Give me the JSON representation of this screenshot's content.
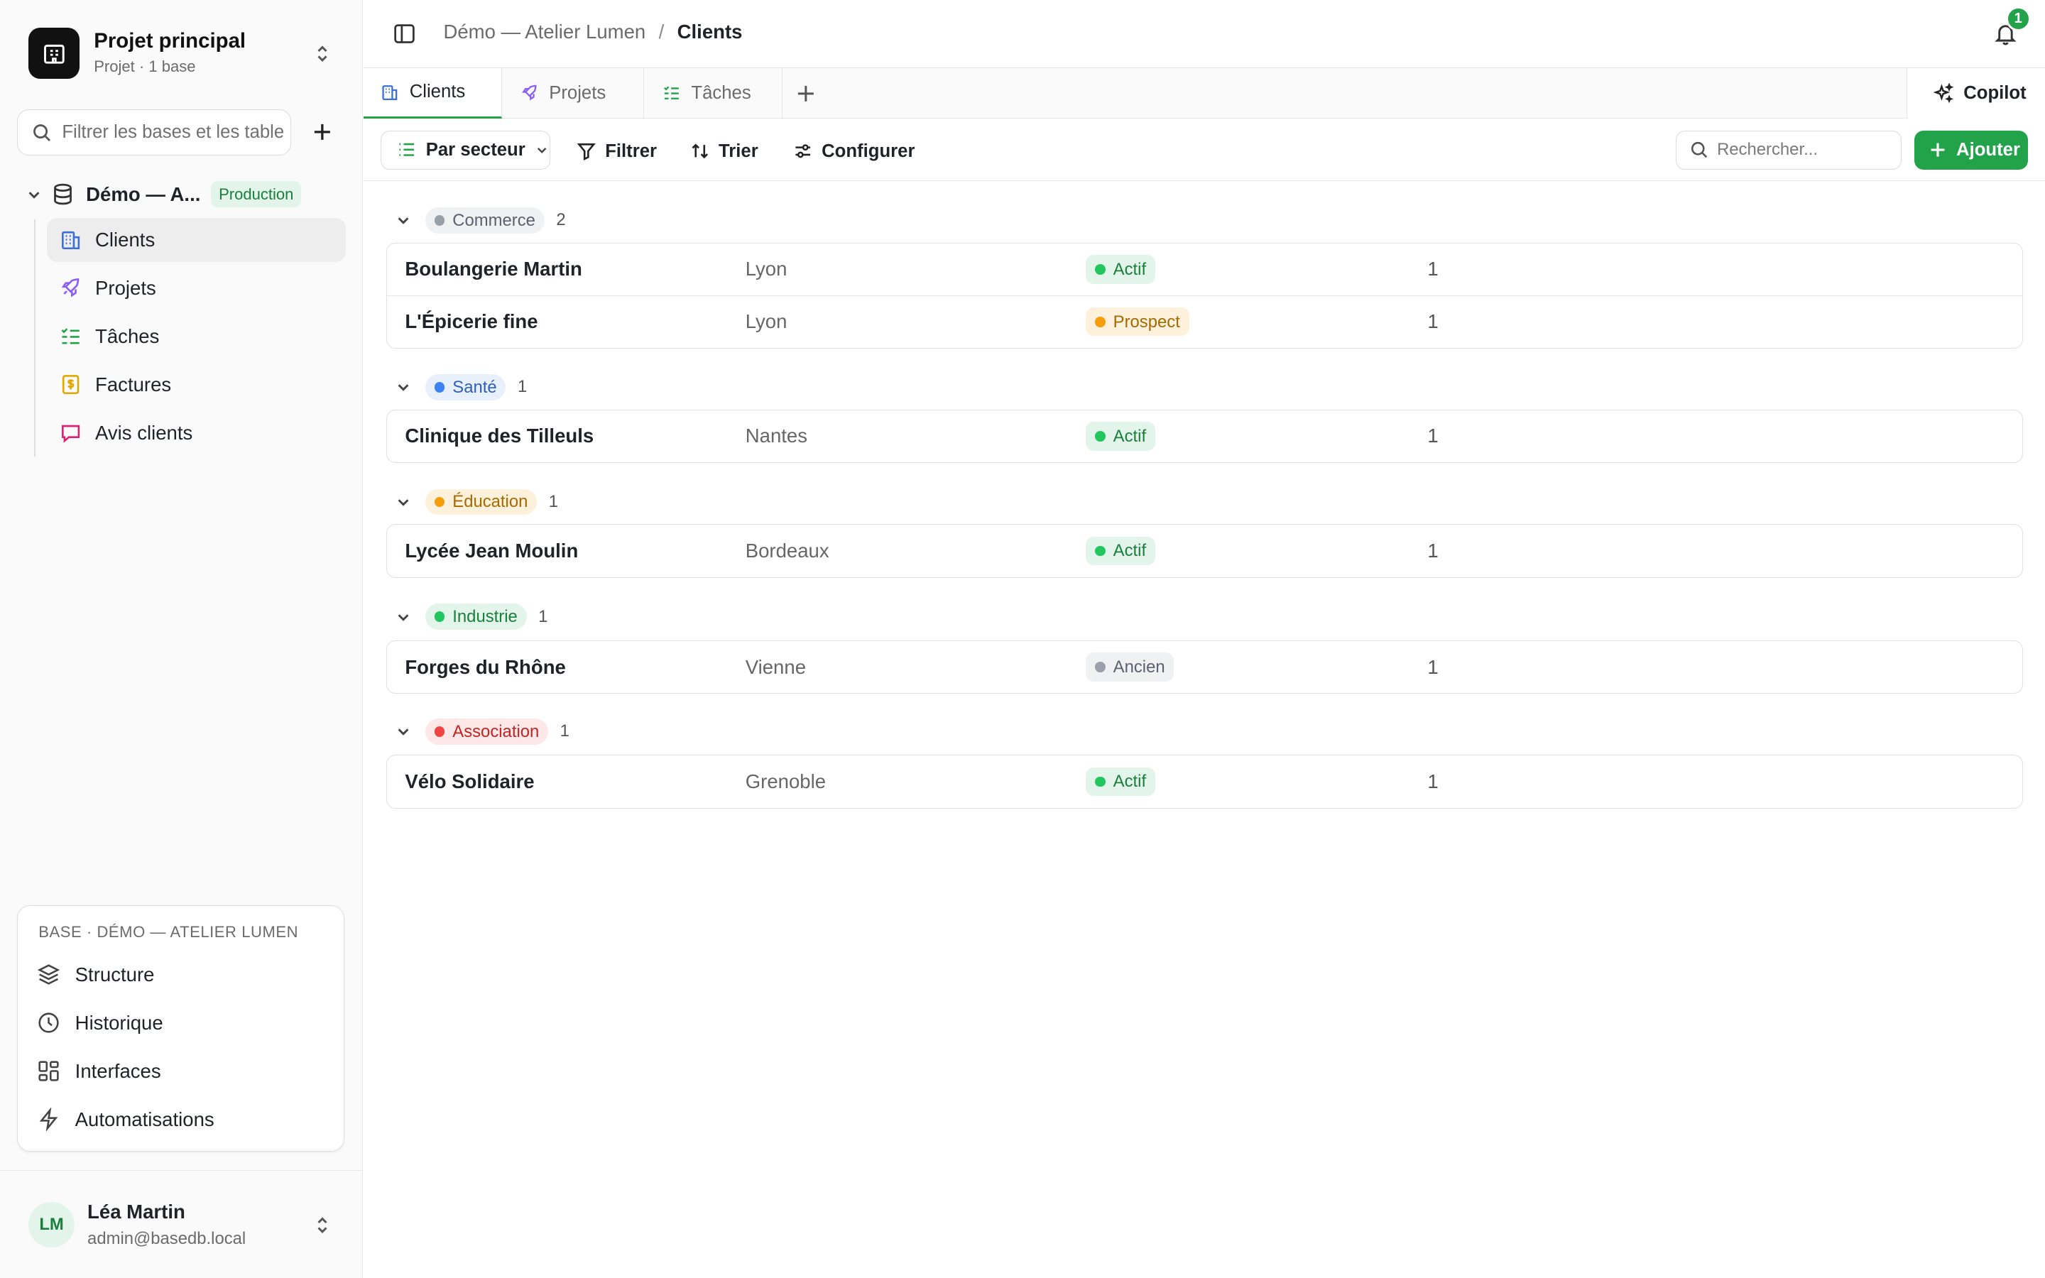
{
  "project": {
    "title": "Projet principal",
    "subtitle": "Projet · 1 base",
    "logo_icon": "building-icon"
  },
  "sidebar": {
    "filter_placeholder": "Filtrer les bases et les tables",
    "base": {
      "name": "Démo — A...",
      "badge": "Production"
    },
    "tables": [
      {
        "label": "Clients",
        "icon": "building-icon",
        "color": "#3b6fd8",
        "active": true
      },
      {
        "label": "Projets",
        "icon": "rocket-icon",
        "color": "#8b5cf6"
      },
      {
        "label": "Tâches",
        "icon": "checklist-icon",
        "color": "#22a34a"
      },
      {
        "label": "Factures",
        "icon": "invoice-icon",
        "color": "#e0a800"
      },
      {
        "label": "Avis clients",
        "icon": "message-icon",
        "color": "#e11d74"
      }
    ],
    "base_panel": {
      "title": "BASE · DÉMO — ATELIER LUMEN",
      "items": [
        {
          "label": "Structure",
          "icon": "layers-icon"
        },
        {
          "label": "Historique",
          "icon": "clock-icon"
        },
        {
          "label": "Interfaces",
          "icon": "grid-icon"
        },
        {
          "label": "Automatisations",
          "icon": "bolt-icon"
        }
      ]
    },
    "user": {
      "initials": "LM",
      "name": "Léa Martin",
      "email": "admin@basedb.local"
    }
  },
  "topbar": {
    "breadcrumb": [
      "Démo — Atelier Lumen",
      "Clients"
    ],
    "separator": "/",
    "notifications": "1"
  },
  "tabs": [
    {
      "label": "Clients",
      "icon": "building-icon",
      "active": true
    },
    {
      "label": "Projets",
      "icon": "rocket-icon"
    },
    {
      "label": "Tâches",
      "icon": "checklist-icon"
    }
  ],
  "copilot_label": "Copilot",
  "toolbar": {
    "group_by": "Par secteur",
    "filter": "Filtrer",
    "sort": "Trier",
    "configure": "Configurer",
    "search_placeholder": "Rechercher...",
    "add": "Ajouter"
  },
  "colors": {
    "accent": "#22a34a"
  },
  "groups": [
    {
      "label": "Commerce",
      "count": "2",
      "dot": "#9aa0aa",
      "bg": "#f0f1f3",
      "fg": "#5b6170",
      "rows": [
        {
          "name": "Boulangerie Martin",
          "city": "Lyon",
          "status": "Actif",
          "count": "1"
        },
        {
          "name": "L'Épicerie fine",
          "city": "Lyon",
          "status": "Prospect",
          "count": "1"
        }
      ]
    },
    {
      "label": "Santé",
      "count": "1",
      "dot": "#3b82f6",
      "bg": "#e8f0fd",
      "fg": "#2f5fb8",
      "rows": [
        {
          "name": "Clinique des Tilleuls",
          "city": "Nantes",
          "status": "Actif",
          "count": "1"
        }
      ]
    },
    {
      "label": "Éducation",
      "count": "1",
      "dot": "#f59e0b",
      "bg": "#fdf1dc",
      "fg": "#a66a00",
      "rows": [
        {
          "name": "Lycée Jean Moulin",
          "city": "Bordeaux",
          "status": "Actif",
          "count": "1"
        }
      ]
    },
    {
      "label": "Industrie",
      "count": "1",
      "dot": "#22c55e",
      "bg": "#e3f5ea",
      "fg": "#1b7f3c",
      "rows": [
        {
          "name": "Forges du Rhône",
          "city": "Vienne",
          "status": "Ancien",
          "count": "1"
        }
      ]
    },
    {
      "label": "Association",
      "count": "1",
      "dot": "#ef4444",
      "bg": "#fde7e7",
      "fg": "#c02626",
      "rows": [
        {
          "name": "Vélo Solidaire",
          "city": "Grenoble",
          "status": "Actif",
          "count": "1"
        }
      ]
    }
  ],
  "status_styles": {
    "Actif": {
      "dot": "#22c55e",
      "bg": "#e3f5ea",
      "fg": "#1b7f3c"
    },
    "Prospect": {
      "dot": "#f59e0b",
      "bg": "#fdf1dc",
      "fg": "#a66a00"
    },
    "Ancien": {
      "dot": "#9aa0aa",
      "bg": "#f0f1f3",
      "fg": "#5b6170"
    }
  }
}
